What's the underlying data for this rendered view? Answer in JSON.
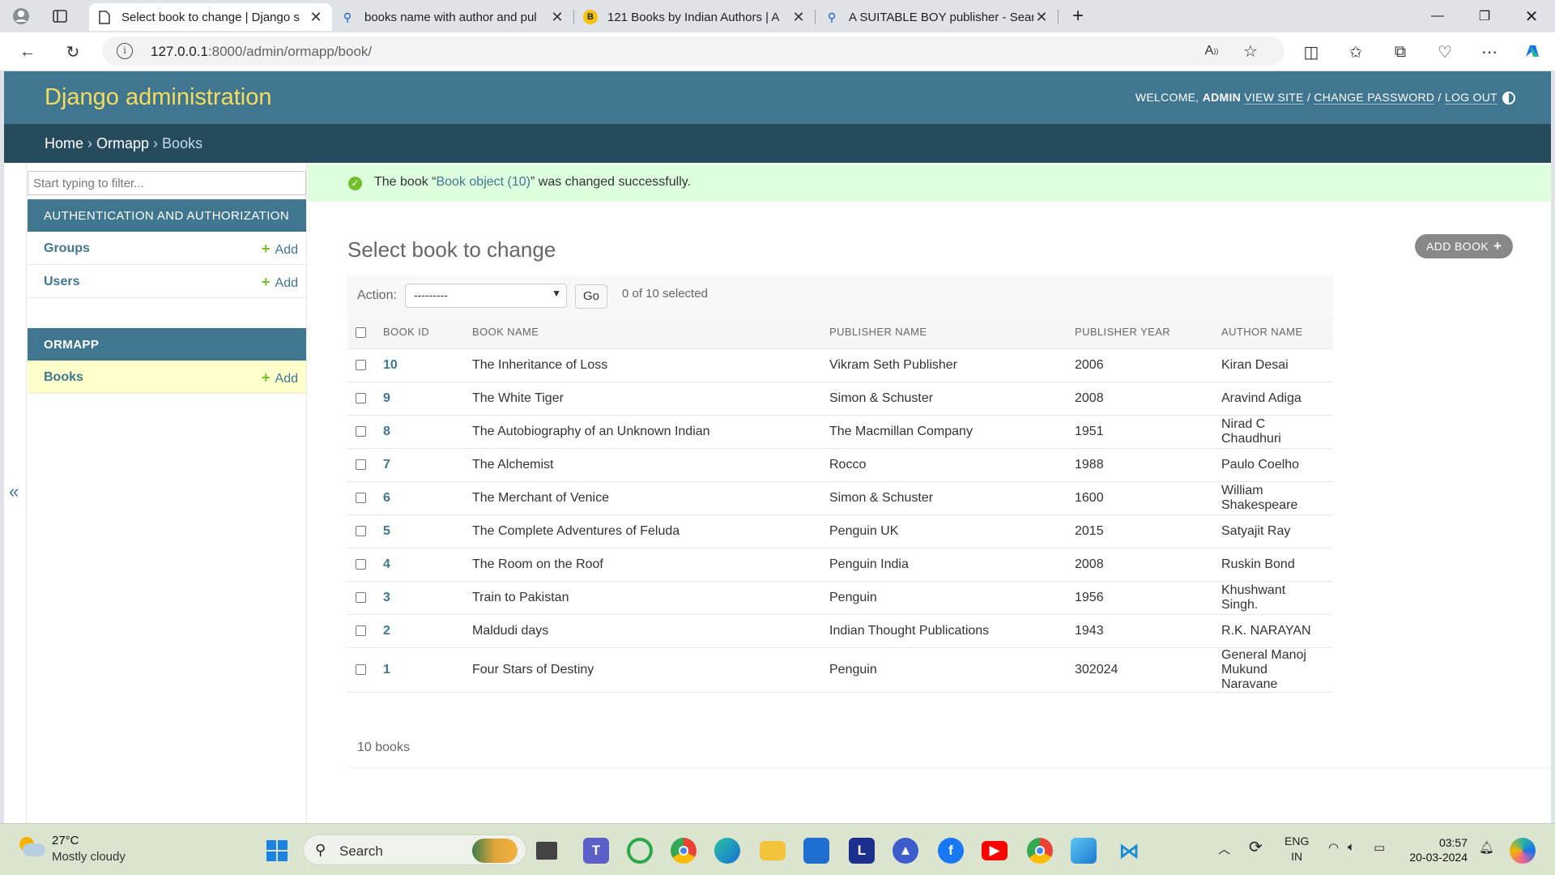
{
  "browser": {
    "tabs": [
      {
        "title": "Select book to change | Django s",
        "active": true
      },
      {
        "title": "books name with author and pul",
        "active": false
      },
      {
        "title": "121 Books by Indian Authors | A",
        "active": false
      },
      {
        "title": "A SUITABLE BOY publisher - Sear",
        "active": false
      }
    ],
    "url_host": "127.0.0.1",
    "url_rest": ":8000/admin/ormapp/book/"
  },
  "admin": {
    "brand": "Django administration",
    "welcome": "WELCOME,",
    "user": "ADMIN",
    "view_site": "VIEW SITE",
    "change_password": "CHANGE PASSWORD",
    "log_out": "LOG OUT",
    "breadcrumb": {
      "home": "Home",
      "app": "Ormapp",
      "current": "Books"
    }
  },
  "sidebar": {
    "filter_placeholder": "Start typing to filter...",
    "collapse_glyph": "«",
    "modules": [
      {
        "caption": "AUTHENTICATION AND AUTHORIZATION",
        "items": [
          {
            "name": "Groups",
            "add": "Add"
          },
          {
            "name": "Users",
            "add": "Add"
          }
        ]
      },
      {
        "caption": "ORMAPP",
        "items": [
          {
            "name": "Books",
            "add": "Add"
          }
        ]
      }
    ]
  },
  "content": {
    "message_prefix": "The book “",
    "message_link": "Book object (10)",
    "message_suffix": "” was changed successfully.",
    "title": "Select book to change",
    "add_button": "ADD BOOK",
    "action_label": "Action:",
    "action_selected": "---------",
    "go": "Go",
    "selected_count": "0 of 10 selected",
    "columns": [
      "BOOK ID",
      "BOOK NAME",
      "PUBLISHER NAME",
      "PUBLISHER YEAR",
      "AUTHOR NAME"
    ],
    "rows": [
      {
        "id": "10",
        "name": "The Inheritance of Loss",
        "publisher": "Vikram Seth Publisher",
        "year": "2006",
        "author": "Kiran Desai"
      },
      {
        "id": "9",
        "name": "The White Tiger",
        "publisher": "Simon & Schuster",
        "year": "2008",
        "author": "Aravind Adiga"
      },
      {
        "id": "8",
        "name": "The Autobiography of an Unknown Indian",
        "publisher": "The Macmillan Company",
        "year": "1951",
        "author": "Nirad C Chaudhuri"
      },
      {
        "id": "7",
        "name": "The Alchemist",
        "publisher": "Rocco",
        "year": "1988",
        "author": "Paulo Coelho"
      },
      {
        "id": "6",
        "name": "The Merchant of Venice",
        "publisher": "Simon & Schuster",
        "year": "1600",
        "author": "William Shakespeare"
      },
      {
        "id": "5",
        "name": "The Complete Adventures of Feluda",
        "publisher": "Penguin UK",
        "year": "2015",
        "author": "Satyajit Ray"
      },
      {
        "id": "4",
        "name": "The Room on the Roof",
        "publisher": "Penguin India",
        "year": "2008",
        "author": "Ruskin Bond"
      },
      {
        "id": "3",
        "name": "Train to Pakistan",
        "publisher": "Penguin",
        "year": "1956",
        "author": "Khushwant Singh."
      },
      {
        "id": "2",
        "name": "Maldudi days",
        "publisher": "Indian Thought Publications",
        "year": "1943",
        "author": "R.K. NARAYAN"
      },
      {
        "id": "1",
        "name": "Four Stars of Destiny",
        "publisher": "Penguin",
        "year": "302024",
        "author": "General Manoj Mukund Naravane"
      }
    ],
    "paginator": "10 books"
  },
  "taskbar": {
    "temperature": "27°C",
    "weather": "Mostly cloudy",
    "search": "Search",
    "lang1": "ENG",
    "lang2": "IN",
    "time": "03:57",
    "date": "20-03-2024"
  },
  "colors": {
    "header": "#417690",
    "breadcrumbs": "#264b5d",
    "brand": "#f5dd5d",
    "success": "#dfd",
    "add_plus": "#70bf2b"
  }
}
